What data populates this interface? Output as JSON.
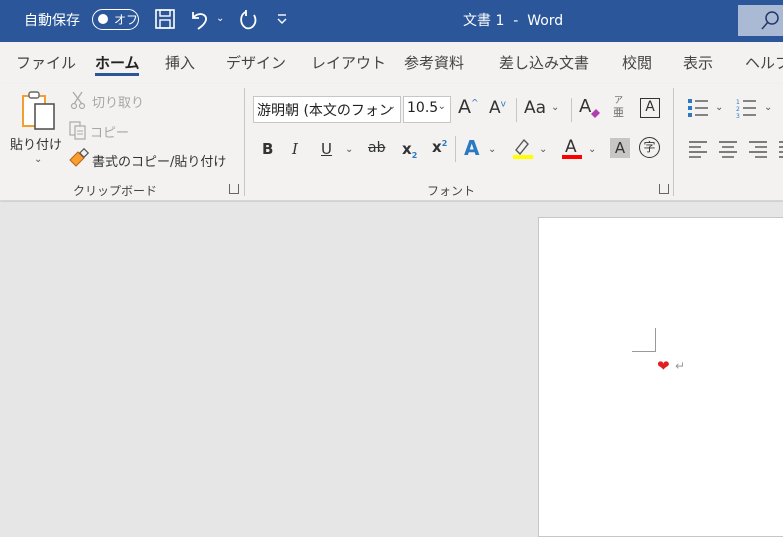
{
  "titlebar": {
    "autosave_label": "自動保存",
    "autosave_state": "オフ",
    "title": "文書 1  -  Word",
    "icons": [
      "save-icon",
      "undo-icon",
      "redo-icon",
      "customize-qat-icon",
      "search-icon"
    ]
  },
  "tabs": [
    {
      "label": "ファイル",
      "active": false
    },
    {
      "label": "ホーム",
      "active": true
    },
    {
      "label": "挿入",
      "active": false
    },
    {
      "label": "デザイン",
      "active": false
    },
    {
      "label": "レイアウト",
      "active": false
    },
    {
      "label": "参考資料",
      "active": false
    },
    {
      "label": "差し込み文書",
      "active": false
    },
    {
      "label": "校閲",
      "active": false
    },
    {
      "label": "表示",
      "active": false
    },
    {
      "label": "ヘルプ",
      "active": false
    }
  ],
  "ribbon": {
    "clipboard": {
      "paste_label": "貼り付け",
      "cut_label": "切り取り",
      "copy_label": "コピー",
      "format_painter_label": "書式のコピー/貼り付け",
      "group_label": "クリップボード"
    },
    "font": {
      "font_name": "游明朝 (本文のフォン",
      "font_size": "10.5",
      "group_label": "フォント",
      "highlight_color": "#ffff00",
      "font_color": "#ff0000",
      "bold": "B",
      "italic": "I",
      "underline": "U",
      "strike": "ab",
      "change_case": "Aa",
      "furigana_top": "ア",
      "furigana_bottom": "亜",
      "char_border": "A",
      "shading": "A",
      "enclose": "字"
    }
  },
  "document": {
    "content_glyph": "❤",
    "paragraph_mark": "↵"
  },
  "colors": {
    "titlebar_bg": "#2b579a",
    "accent": "#2b579a",
    "ribbon_bg": "#f3f2f1",
    "canvas_bg": "#e6e6e6"
  }
}
